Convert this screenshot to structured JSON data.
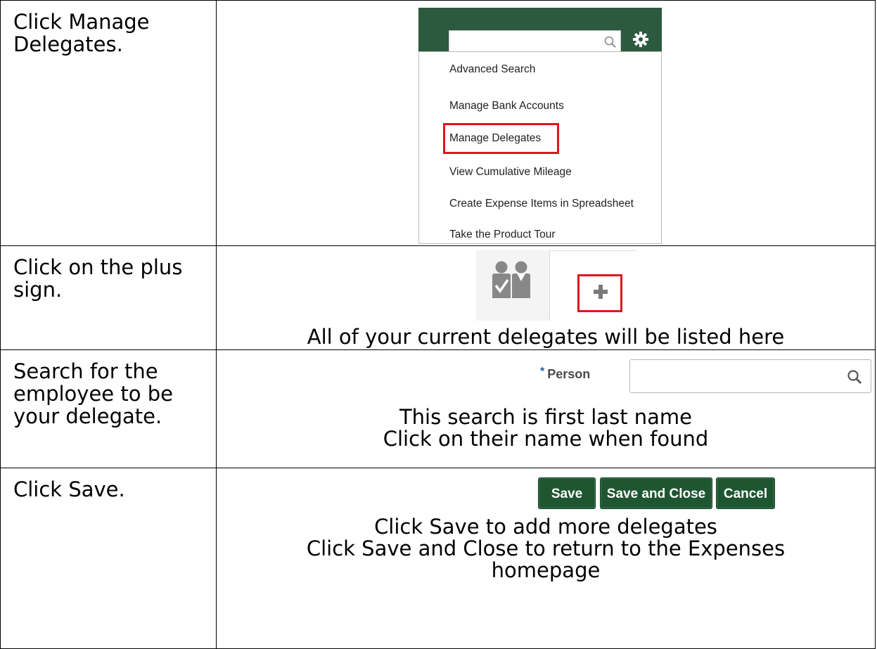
{
  "steps": [
    {
      "instruction": "Click Manage Delegates.",
      "menu": {
        "items": [
          "Advanced Search",
          "Manage Bank Accounts",
          "Manage Delegates",
          "View Cumulative Mileage",
          "Create Expense Items in Spreadsheet",
          "Take the Product Tour"
        ],
        "highlighted": "Manage Delegates"
      }
    },
    {
      "instruction": "Click on the plus sign.",
      "caption": "All of your current delegates will be listed here"
    },
    {
      "instruction": "Search for the employee to be your delegate.",
      "field_label": "Person",
      "required_marker": "*",
      "caption_line1": "This search is first last name",
      "caption_line2": "Click on their name when found"
    },
    {
      "instruction": "Click Save.",
      "buttons": [
        "Save",
        "Save and Close",
        "Cancel"
      ],
      "caption_line1": "Click Save to add more delegates",
      "caption_line2": "Click Save and Close to return to the Expenses",
      "caption_line3": "homepage"
    }
  ],
  "colors": {
    "brand_green": "#1e5632",
    "highlight_red": "#e0141e",
    "required_blue": "#1f5fa8"
  },
  "icons": [
    "search-icon",
    "gear-icon",
    "delegates-people-icon",
    "plus-icon"
  ]
}
